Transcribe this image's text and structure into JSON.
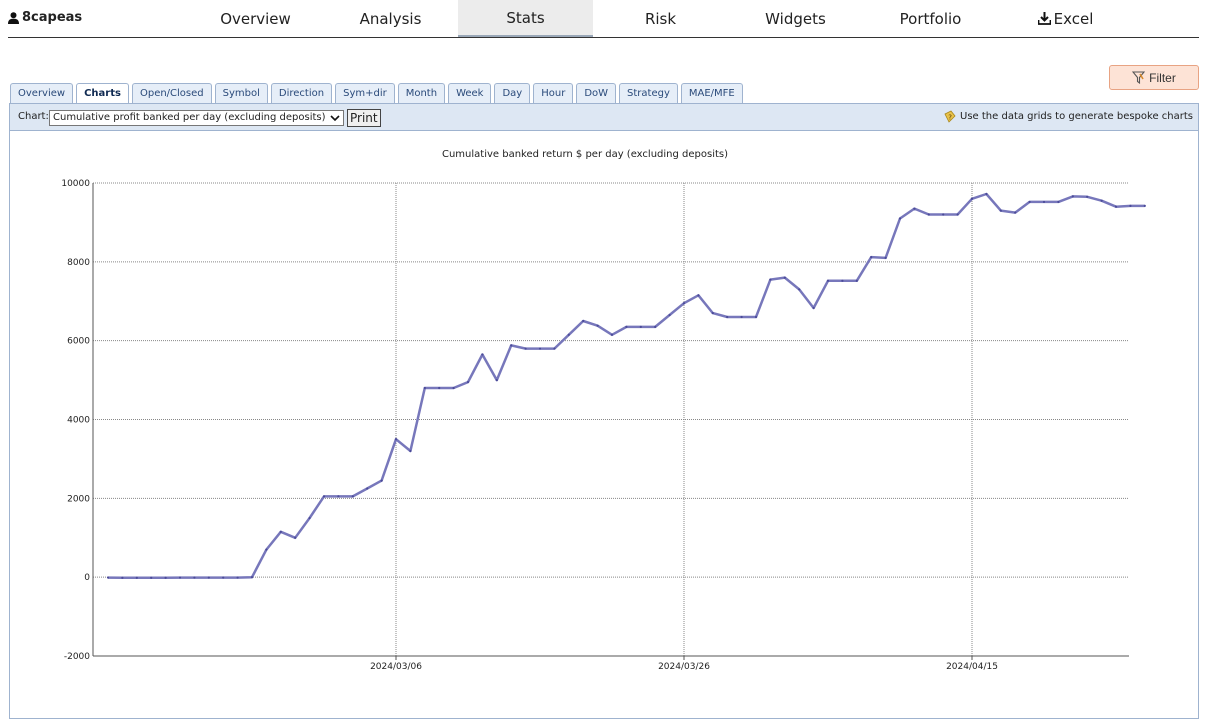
{
  "app": {
    "user": "8capeas",
    "user_icon": "person-icon"
  },
  "nav": {
    "items": [
      {
        "label": "Overview",
        "active": false
      },
      {
        "label": "Analysis",
        "active": false
      },
      {
        "label": "Stats",
        "active": true
      },
      {
        "label": "Risk",
        "active": false
      },
      {
        "label": "Widgets",
        "active": false
      },
      {
        "label": "Portfolio",
        "active": false
      },
      {
        "label": "Excel",
        "active": false,
        "icon": "download-icon"
      }
    ]
  },
  "filter": {
    "label": "Filter",
    "icon": "filter-icon",
    "color": "#fde3d6"
  },
  "subtabs": [
    {
      "label": "Overview",
      "active": false
    },
    {
      "label": "Charts",
      "active": true
    },
    {
      "label": "Open/Closed",
      "active": false
    },
    {
      "label": "Symbol",
      "active": false
    },
    {
      "label": "Direction",
      "active": false
    },
    {
      "label": "Sym+dir",
      "active": false
    },
    {
      "label": "Month",
      "active": false
    },
    {
      "label": "Week",
      "active": false
    },
    {
      "label": "Day",
      "active": false
    },
    {
      "label": "Hour",
      "active": false
    },
    {
      "label": "DoW",
      "active": false
    },
    {
      "label": "Strategy",
      "active": false
    },
    {
      "label": "MAE/MFE",
      "active": false
    }
  ],
  "toolbar": {
    "chart_label": "Chart:",
    "chart_selected": "Cumulative profit banked per day (excluding deposits)",
    "print_label": "Print",
    "hint": "Use the data grids to generate bespoke charts",
    "hint_icon": "lightbulb-help-icon"
  },
  "chart_data": {
    "type": "line",
    "title": "Cumulative banked return $ per day (excluding deposits)",
    "xlabel": "",
    "ylabel": "",
    "ylim": [
      -2000,
      10000
    ],
    "yticks": [
      -2000,
      0,
      2000,
      4000,
      6000,
      8000,
      10000
    ],
    "xtick_labels": [
      "2024/03/06",
      "2024/03/26",
      "2024/04/15"
    ],
    "grid": true,
    "line_color": "#7777bb",
    "series": [
      {
        "x": [
          "2024/02/15",
          "2024/02/16",
          "2024/02/17",
          "2024/02/18",
          "2024/02/19",
          "2024/02/20",
          "2024/02/21",
          "2024/02/22",
          "2024/02/23",
          "2024/02/24",
          "2024/02/25",
          "2024/02/26",
          "2024/02/27",
          "2024/02/28",
          "2024/02/29",
          "2024/03/01",
          "2024/03/02",
          "2024/03/03",
          "2024/03/04",
          "2024/03/05",
          "2024/03/06",
          "2024/03/07",
          "2024/03/08",
          "2024/03/09",
          "2024/03/10",
          "2024/03/11",
          "2024/03/12",
          "2024/03/13",
          "2024/03/14",
          "2024/03/15",
          "2024/03/16",
          "2024/03/17",
          "2024/03/18",
          "2024/03/19",
          "2024/03/20",
          "2024/03/21",
          "2024/03/22",
          "2024/03/23",
          "2024/03/24",
          "2024/03/25",
          "2024/03/26",
          "2024/03/27",
          "2024/03/28",
          "2024/03/29",
          "2024/03/30",
          "2024/03/31",
          "2024/04/01",
          "2024/04/02",
          "2024/04/03",
          "2024/04/04",
          "2024/04/05",
          "2024/04/06",
          "2024/04/07",
          "2024/04/08",
          "2024/04/09",
          "2024/04/10",
          "2024/04/11",
          "2024/04/12",
          "2024/04/13",
          "2024/04/14",
          "2024/04/15",
          "2024/04/16",
          "2024/04/17",
          "2024/04/18",
          "2024/04/19",
          "2024/04/20",
          "2024/04/21",
          "2024/04/22",
          "2024/04/23",
          "2024/04/24",
          "2024/04/25",
          "2024/04/26",
          "2024/04/27"
        ],
        "values": [
          -10,
          -15,
          -15,
          -15,
          -15,
          -10,
          -10,
          -10,
          -10,
          -10,
          0,
          700,
          1150,
          1000,
          1500,
          2050,
          2050,
          2050,
          2250,
          2450,
          3500,
          3200,
          4800,
          4800,
          4800,
          4950,
          5650,
          5000,
          5880,
          5800,
          5800,
          5800,
          6150,
          6500,
          6380,
          6150,
          6350,
          6350,
          6350,
          6650,
          6950,
          7150,
          6700,
          6600,
          6600,
          6600,
          7550,
          7600,
          7300,
          6830,
          7520,
          7520,
          7520,
          8120,
          8100,
          9100,
          9350,
          9200,
          9200,
          9200,
          9600,
          9720,
          9300,
          9250,
          9520,
          9520,
          9520,
          9660,
          9650,
          9550,
          9400,
          9420,
          9420
        ]
      }
    ]
  }
}
